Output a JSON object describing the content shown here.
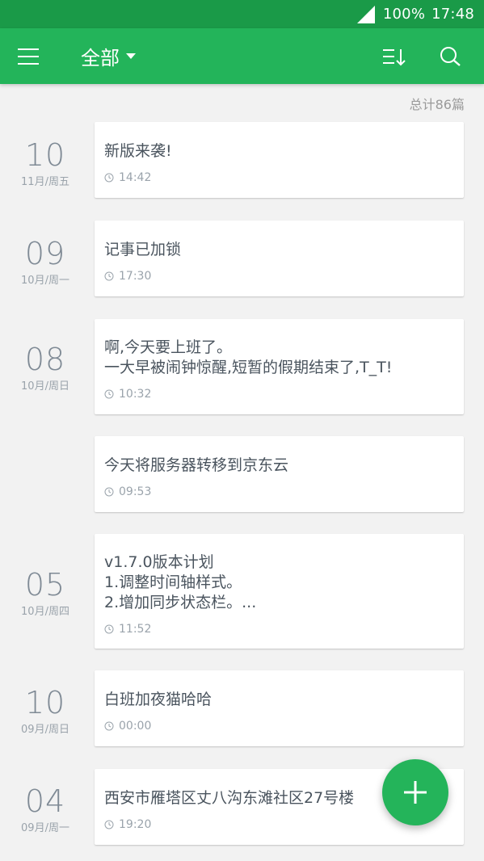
{
  "status_bar": {
    "battery": "100%",
    "time": "17:48"
  },
  "app_bar": {
    "title": "全部",
    "icons": [
      "menu-icon",
      "sort-icon",
      "search-icon"
    ]
  },
  "total": "总计86篇",
  "notes": [
    {
      "day": "10",
      "sub": "11月/周五",
      "text": "新版来袭!",
      "time": "14:42"
    },
    {
      "day": "09",
      "sub": "10月/周一",
      "text": "记事已加锁",
      "time": "17:30"
    },
    {
      "day": "08",
      "sub": "10月/周日",
      "text": "啊,今天要上班了。\n一大早被闹钟惊醒,短暂的假期结束了,T_T!",
      "time": "10:32"
    },
    {
      "day": "",
      "sub": "",
      "text": "今天将服务器转移到京东云",
      "time": "09:53"
    },
    {
      "day": "05",
      "sub": "10月/周四",
      "text": "v1.7.0版本计划\n1.调整时间轴样式。\n2.增加同步状态栏。...",
      "time": "11:52"
    },
    {
      "day": "10",
      "sub": "09月/周日",
      "text": "白班加夜猫哈哈",
      "time": "00:00"
    },
    {
      "day": "04",
      "sub": "09月/周一",
      "text": "西安市雁塔区丈八沟东滩社区27号楼",
      "time": "19:20"
    }
  ],
  "colors": {
    "primary": "#23b45a",
    "status_bar": "#1a9a48",
    "background": "#f2f2f2"
  },
  "fab": {
    "icon": "plus-icon"
  }
}
